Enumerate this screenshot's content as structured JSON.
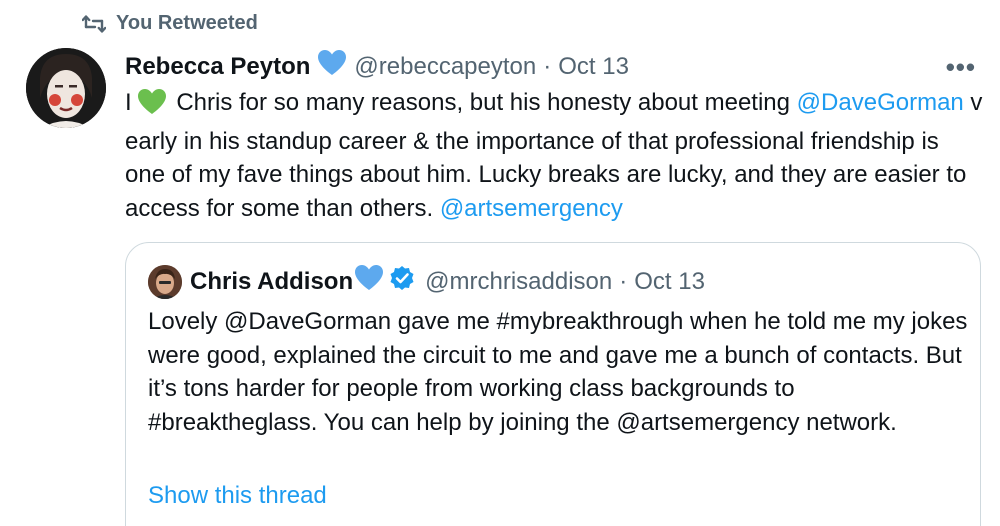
{
  "retweet": {
    "label": "You Retweeted"
  },
  "tweet": {
    "author_name": "Rebecca Peyton",
    "handle": "@rebeccapeyton",
    "separator": "·",
    "date": "Oct 13",
    "more": "•••",
    "text_parts": [
      "I",
      " Chris for so many reasons, but his honesty about meeting ",
      "@DaveGorman",
      " v early in his standup career & the importance of that professional friendship is one of my fave things about him. Lucky breaks are lucky, and they are easier to access for some than others. ",
      "@artsemergency"
    ]
  },
  "quote": {
    "author_name": "Chris Addison",
    "handle": "@mrchrisaddison",
    "separator": "·",
    "date": "Oct 13",
    "text": "Lovely @DaveGorman gave me #mybreakthrough when he told me my jokes were good, explained the circuit to me and gave me a bunch of contacts. But it’s tons harder for people from working class backgrounds to #breaktheglass. You can help by joining the @artsemergency network.",
    "show_thread": "Show this thread"
  },
  "colors": {
    "link": "#1d9bf0",
    "secondary": "#536471",
    "border": "#cfd9de",
    "blue_heart": "#5da9ee",
    "green_heart": "#6bbf4e",
    "verified": "#1d9bf0"
  },
  "icons": [
    "retweet-icon",
    "blue-heart-icon",
    "green-heart-icon",
    "verified-badge-icon",
    "more-icon"
  ]
}
